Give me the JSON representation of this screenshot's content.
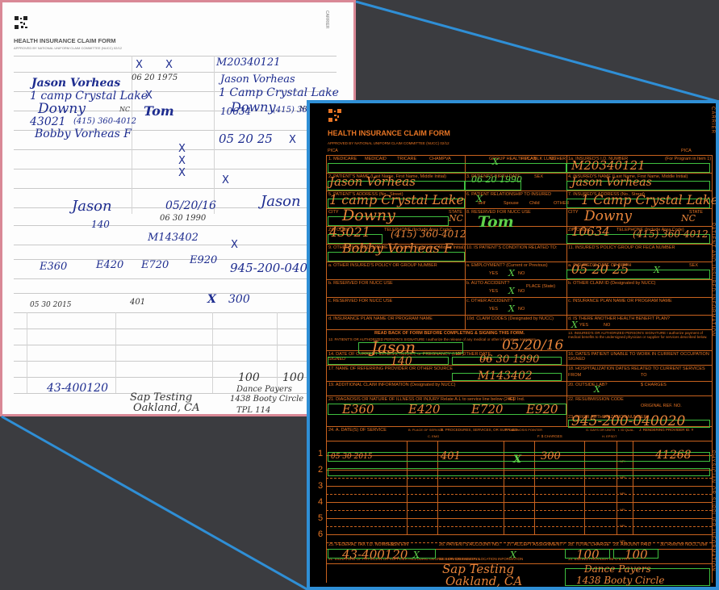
{
  "form": {
    "title": "HEALTH INSURANCE CLAIM FORM",
    "approved": "APPROVED BY NATIONAL UNIFORM CLAIM COMMITTEE (NUCC) 02/12",
    "pica": "PICA",
    "carrier": "CARRIER",
    "patient_insured": "PATIENT AND INSURED INFORMATION",
    "physician_supplier": "PHYSICIAN OR SUPPLIER INFORMATION"
  },
  "labels": {
    "medicare": "1. MEDICARE",
    "medicaid": "MEDICAID",
    "tricare": "TRICARE",
    "champva": "CHAMPVA",
    "group_plan": "GROUP HEALTH PLAN",
    "feca": "FECA BLK LUNG",
    "other": "OTHER",
    "insured_id": "1a. INSURED'S I.D. NUMBER",
    "for_program": "(For Program in Item 1)",
    "patient_name": "2. PATIENT'S NAME (Last Name, First Name, Middle Initial)",
    "birth_date": "3. PATIENT'S BIRTH DATE",
    "sex": "SEX",
    "insured_name": "4. INSURED'S NAME (Last Name, First Name, Middle Initial)",
    "patient_address": "5. PATIENT'S ADDRESS (No., Street)",
    "relationship": "6. PATIENT RELATIONSHIP TO INSURED",
    "self": "Self",
    "spouse": "Spouse",
    "child": "Child",
    "insured_address": "7. INSURED'S ADDRESS (No., Street)",
    "city": "CITY",
    "state": "STATE",
    "reserved_nucc": "8. RESERVED FOR NUCC USE",
    "zip": "ZIP CODE",
    "telephone": "TELEPHONE (Include Area Code)",
    "other_insured": "9. OTHER INSURED'S NAME (Last Name, First Name, Middle Initial)",
    "condition": "10. IS PATIENT'S CONDITION RELATED TO:",
    "group_number": "11. INSURED'S POLICY GROUP OR FECA NUMBER",
    "other_policy": "a. OTHER INSURED'S POLICY OR GROUP NUMBER",
    "employment": "a. EMPLOYMENT? (Current or Previous)",
    "insured_dob": "a. INSURED'S DATE OF BIRTH",
    "reserved_b": "b. RESERVED FOR NUCC USE",
    "auto_accident": "b. AUTO ACCIDENT?",
    "place_state": "PLACE (State)",
    "other_claim_id": "b. OTHER CLAIM ID (Designated by NUCC)",
    "reserved_c": "c. RESERVED FOR NUCC USE",
    "other_accident": "c. OTHER ACCIDENT?",
    "plan_name": "c. INSURANCE PLAN NAME OR PROGRAM NAME",
    "plan_name_d": "d. INSURANCE PLAN NAME OR PROGRAM NAME",
    "claim_codes": "10d. CLAIM CODES (Designated by NUCC)",
    "another_plan": "d. IS THERE ANOTHER HEALTH BENEFIT PLAN?",
    "yes": "YES",
    "no": "NO",
    "read_back": "READ BACK OF FORM BEFORE COMPLETING & SIGNING THIS FORM.",
    "auth_sig": "12. PATIENT'S OR AUTHORIZED PERSON'S SIGNATURE I authorize the release of any medical or other information necessary",
    "insured_sig": "13. INSURED'S OR AUTHORIZED PERSON'S SIGNATURE I authorize payment of medical benefits to the undersigned physician or supplier for services described below.",
    "signed": "SIGNED",
    "date": "DATE",
    "date_illness": "14. DATE OF CURRENT ILLNESS, INJURY, or PREGNANCY (LMP)",
    "other_date": "15. OTHER DATE",
    "unable_work": "16. DATES PATIENT UNABLE TO WORK IN CURRENT OCCUPATION",
    "referring": "17. NAME OF REFERRING PROVIDER OR OTHER SOURCE",
    "hosp_dates": "18. HOSPITALIZATION DATES RELATED TO CURRENT SERVICES",
    "additional": "19. ADDITIONAL CLAIM INFORMATION (Designated by NUCC)",
    "outside_lab": "20. OUTSIDE LAB?",
    "charges": "$ CHARGES",
    "diagnosis": "21. DIAGNOSIS OR NATURE OF ILLNESS OR INJURY Relate A-L to service line below (24E)",
    "icd": "ICD Ind.",
    "resubmission": "22. RESUBMISSION CODE",
    "original_ref": "ORIGINAL REF. NO.",
    "prior_auth": "23. PRIOR AUTHORIZATION NUMBER",
    "date_service": "24. A. DATE(S) OF SERVICE",
    "place": "B. PLACE OF SERVICE",
    "emg": "C. EMG",
    "procedures": "D. PROCEDURES, SERVICES, OR SUPPLIES",
    "dx_pointer": "E. DIAGNOSIS POINTER",
    "f_charges": "F. $ CHARGES",
    "days": "G. DAYS OR UNITS",
    "epsdt": "H. EPSDT",
    "id_qual": "I. ID QUAL.",
    "rendering": "J. RENDERING PROVIDER ID. #",
    "npi": "NPI",
    "tax_id": "25. FEDERAL TAX I.D. NUMBER",
    "ssn_ein": "SSN EIN",
    "account_no": "26. PATIENT'S ACCOUNT NO.",
    "accept": "27. ACCEPT ASSIGNMENT?",
    "total_charge": "28. TOTAL CHARGE",
    "amount_paid": "29. AMOUNT PAID",
    "rsvd": "30. Rsvd for NUCC Use",
    "physician_sig": "31. SIGNATURE OF PHYSICIAN OR SUPPLIER INCLUDING DEGREES OR CREDENTIALS",
    "facility": "32. SERVICE FACILITY LOCATION INFORMATION",
    "billing": "33. BILLING PROVIDER INFO & PH #",
    "from": "FROM",
    "to": "TO"
  },
  "values": {
    "insured_id": "M20340121",
    "patient_name": "Jason Vorheas",
    "birth_date": "06 20 1990",
    "birth_date_scan": "06 20 1975",
    "insured_name": "Jason Vorheas",
    "patient_address": "1 camp Crystal Lake",
    "insured_address": "1 Camp Crystal Lake",
    "city": "Downy",
    "state": "NC",
    "reserved": "Tom",
    "zip": "43021",
    "phone": "(415) 360-4012",
    "insured_city": "Downy",
    "insured_state": "NC",
    "insured_zip": "10634",
    "insured_phone": "(415) 360-4012",
    "other_insured": "Bobby Vorheas F",
    "insured_dob": "05 20 25",
    "sig_date": "05/20/16",
    "illness_date": "140",
    "other_date": "06 30 1990",
    "referring": "M143402",
    "dx_a": "E360",
    "dx_b": "E420",
    "dx_c": "E720",
    "dx_d": "E920",
    "prior_auth": "945-200-040020",
    "line1_date": "05 30 2015",
    "line1_pos": "401",
    "line1_charge": "300",
    "line1_npi": "41268",
    "tax_id": "43-400120",
    "total": "100",
    "paid": "100",
    "facility_1": "Sap Testing",
    "facility_2": "Oakland, CA",
    "billing_1": "Dance Payers",
    "billing_2": "1438 Booty Circle",
    "billing_3": "TPL 114",
    "scan_sig": "Jason",
    "row_numbers": [
      "1",
      "2",
      "3",
      "4",
      "5",
      "6"
    ],
    "check": "X"
  }
}
